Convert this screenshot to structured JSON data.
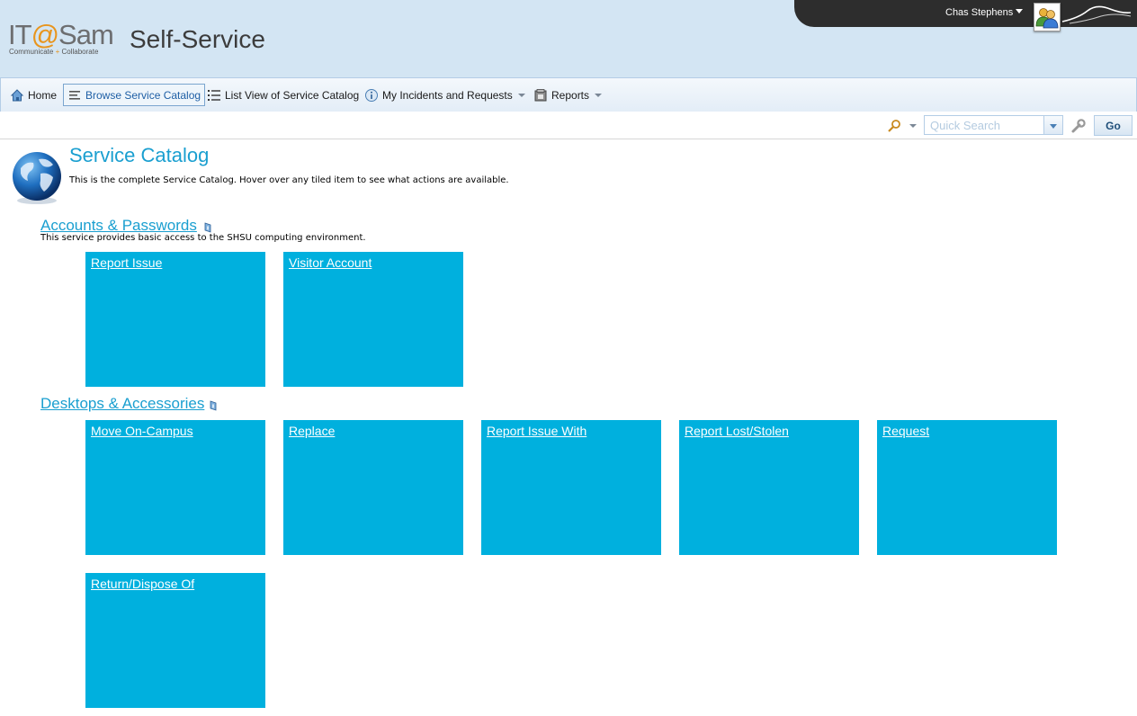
{
  "header": {
    "logo": {
      "main_prefix": "IT",
      "main_at": "@",
      "main_suffix": "Sam",
      "tag_left": "Communicate",
      "tag_plus": "+",
      "tag_right": "Collaborate"
    },
    "app_title": "Self-Service",
    "user": {
      "name": "Chas Stephens",
      "avatar_icon": "users-icon"
    }
  },
  "nav": {
    "items": [
      {
        "label": "Home",
        "icon": "home-icon"
      },
      {
        "label": "Browse Service Catalog",
        "icon": "catalog-icon",
        "active": true
      },
      {
        "label": "List View of Service Catalog",
        "icon": "list-icon"
      },
      {
        "label": "My Incidents and Requests",
        "icon": "info-icon",
        "dropdown": true
      },
      {
        "label": "Reports",
        "icon": "report-icon",
        "dropdown": true
      }
    ]
  },
  "search": {
    "placeholder": "Quick Search",
    "go_label": "Go"
  },
  "page": {
    "title": "Service Catalog",
    "description": "This is the complete Service Catalog. Hover over any tiled item to see what actions are available."
  },
  "categories": [
    {
      "title": "Accounts & Passwords",
      "description": "This service provides basic access to the SHSU computing environment.",
      "tiles": [
        "Report Issue",
        "Visitor Account"
      ]
    },
    {
      "title": "Desktops & Accessories",
      "description": "",
      "tiles": [
        "Move On-Campus",
        "Replace",
        "Report Issue With",
        "Report Lost/Stolen",
        "Request",
        "Return/Dispose Of"
      ]
    }
  ],
  "colors": {
    "accent": "#1a9fd0",
    "tile": "#00b0de",
    "header_bg": "#d3e5f3",
    "userbar": "#2d2d2d"
  }
}
